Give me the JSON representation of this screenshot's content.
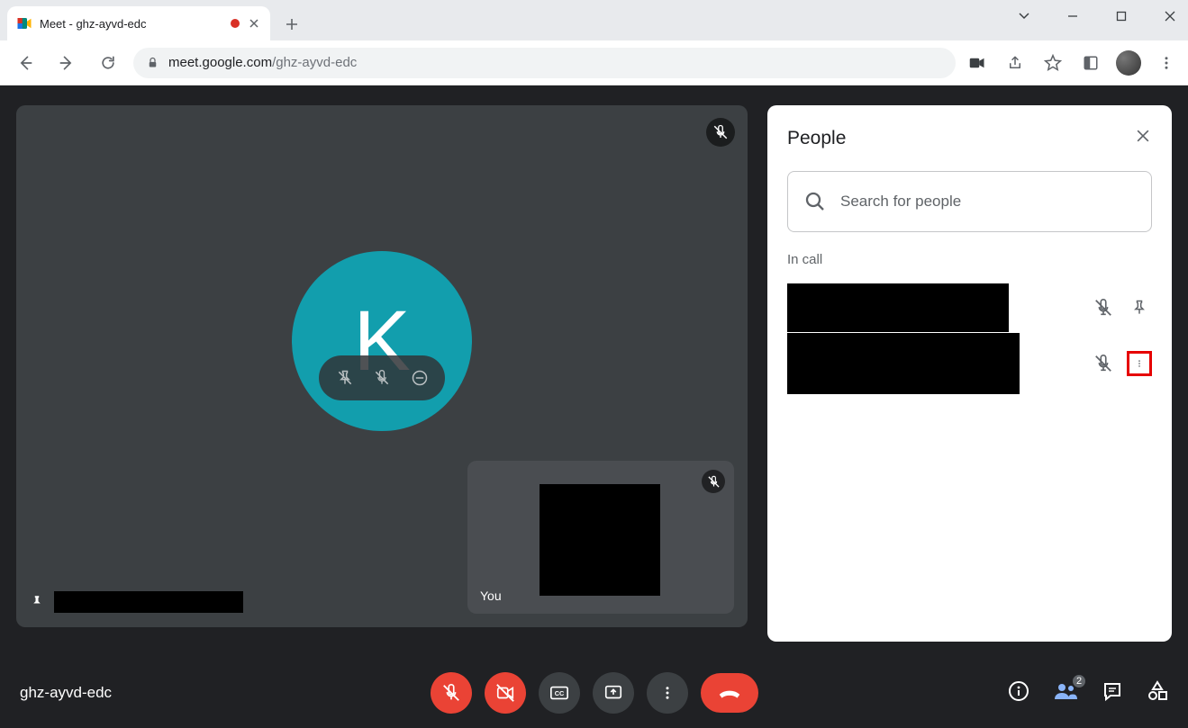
{
  "browser": {
    "tab_title": "Meet - ghz-ayvd-edc",
    "url_domain": "meet.google.com",
    "url_path": "/ghz-ayvd-edc"
  },
  "meet": {
    "meeting_code": "ghz-ayvd-edc",
    "main_tile": {
      "avatar_letter": "K",
      "avatar_color": "#129ead"
    },
    "self_tile": {
      "label": "You"
    },
    "people_badge_count": "2"
  },
  "people_panel": {
    "title": "People",
    "search_placeholder": "Search for people",
    "section_label": "In call"
  }
}
